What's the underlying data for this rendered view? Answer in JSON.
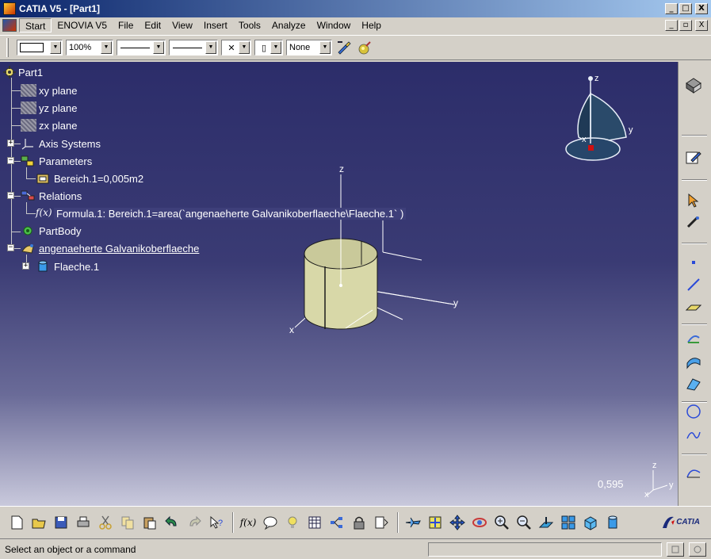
{
  "window": {
    "title": "CATIA V5 - [Part1]",
    "buttons": {
      "minimize": "_",
      "maximize": "□",
      "close": "X"
    }
  },
  "menu": {
    "items": [
      "Start",
      "ENOVIA V5",
      "File",
      "Edit",
      "View",
      "Insert",
      "Tools",
      "Analyze",
      "Window",
      "Help"
    ],
    "doc_buttons": {
      "minimize": "_",
      "restore": "▫",
      "close": "X"
    }
  },
  "format_toolbar": {
    "zoom": "100%",
    "layer": "None"
  },
  "tree": {
    "root": "Part1",
    "xy_plane": "xy plane",
    "yz_plane": "yz plane",
    "zx_plane": "zx plane",
    "axis_systems": "Axis Systems",
    "parameters": "Parameters",
    "parameter_1": "Bereich.1=0,005m2",
    "relations": "Relations",
    "formula_1": "Formula.1: Bereich.1=area(`angenaeherte Galvanikoberflaeche\\Flaeche.1` )",
    "part_body": "PartBody",
    "geo_set": "angenaeherte Galvanikoberflaeche",
    "surface_1": "Flaeche.1"
  },
  "scene": {
    "axis_labels": {
      "z": "z",
      "y": "y",
      "x": "x"
    },
    "compass_labels": {
      "z": "z",
      "y": "y",
      "x": "x"
    },
    "mini_axis_labels": {
      "z": "z",
      "y": "y",
      "x": "x"
    },
    "zoom_value": "0,595",
    "cylinder_color": "#d8d8a8"
  },
  "status": {
    "prompt": "Select an object or a command"
  },
  "logo": {
    "text": "CATIA"
  }
}
